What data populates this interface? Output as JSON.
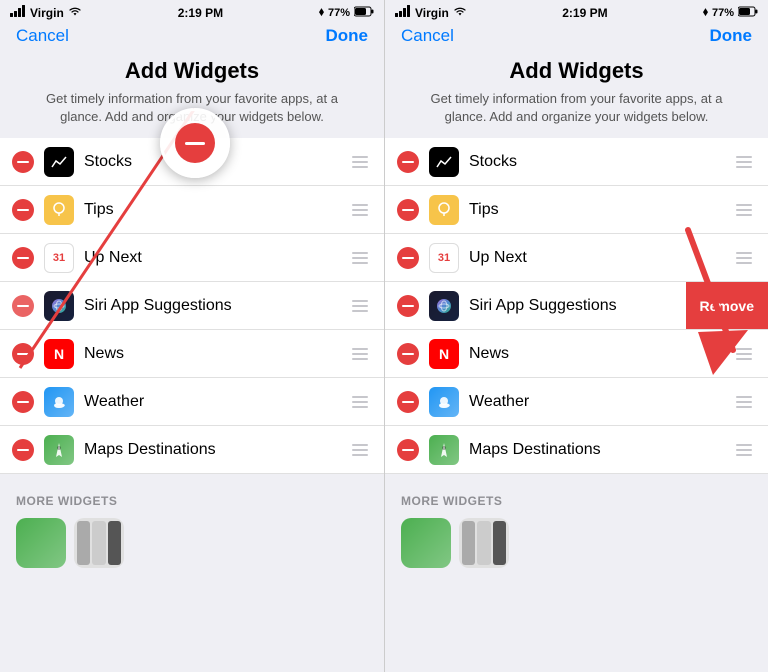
{
  "panels": [
    {
      "id": "left",
      "statusBar": {
        "carrier": "Virgin",
        "time": "2:19 PM",
        "bluetooth": "B",
        "battery": "77%"
      },
      "nav": {
        "cancel": "Cancel",
        "done": "Done"
      },
      "header": {
        "title": "Add Widgets",
        "desc": "Get timely information from your favorite apps, at a glance. Add and organize your widgets below."
      },
      "widgets": [
        {
          "name": "Stocks",
          "icon": "stocks"
        },
        {
          "name": "Tips",
          "icon": "tips"
        },
        {
          "name": "Up Next",
          "icon": "upnext",
          "label31": "31"
        },
        {
          "name": "Siri App Suggestions",
          "icon": "siri",
          "highlighted": true
        },
        {
          "name": "News",
          "icon": "news"
        },
        {
          "name": "Weather",
          "icon": "weather"
        },
        {
          "name": "Maps Destinations",
          "icon": "maps"
        }
      ],
      "moreSection": {
        "title": "MORE WIDGETS"
      },
      "hasAnnotationCircle": true
    },
    {
      "id": "right",
      "statusBar": {
        "carrier": "Virgin",
        "time": "2:19 PM",
        "bluetooth": "B",
        "battery": "77%"
      },
      "nav": {
        "cancel": "Cancel",
        "done": "Done"
      },
      "header": {
        "title": "Add Widgets",
        "desc": "Get timely information from your favorite apps, at a glance. Add and organize your widgets below."
      },
      "widgets": [
        {
          "name": "Stocks",
          "icon": "stocks"
        },
        {
          "name": "Tips",
          "icon": "tips"
        },
        {
          "name": "Up Next",
          "icon": "upnext",
          "label31": "31"
        },
        {
          "name": "Siri App Suggestions",
          "icon": "siri",
          "highlighted": true,
          "showRemove": true
        },
        {
          "name": "News",
          "icon": "news"
        },
        {
          "name": "Weather",
          "icon": "weather"
        },
        {
          "name": "Maps Destinations",
          "icon": "maps"
        }
      ],
      "moreSection": {
        "title": "MORE WIDGETS"
      },
      "removeLabel": "Remove",
      "hasArrow": true
    }
  ]
}
